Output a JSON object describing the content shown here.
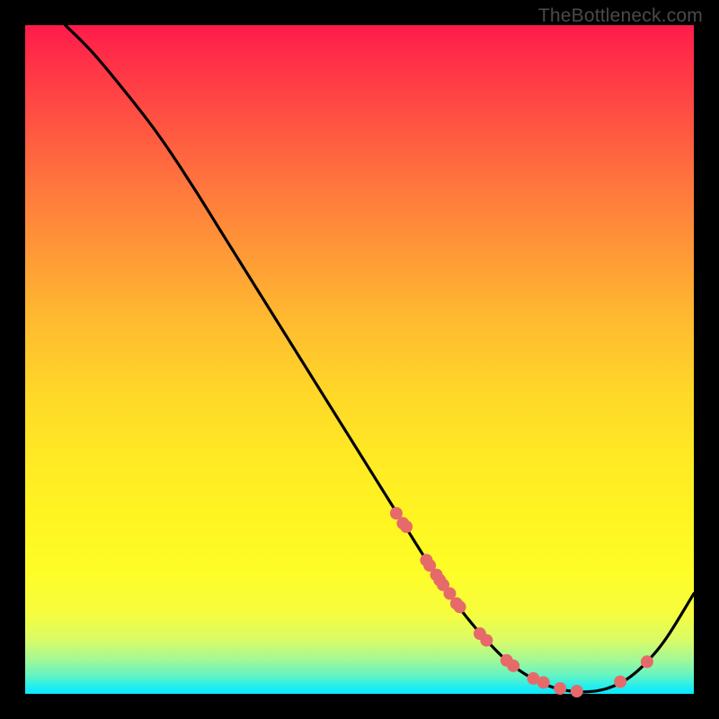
{
  "watermark": "TheBottleneck.com",
  "chart_data": {
    "type": "line",
    "title": "",
    "xlabel": "",
    "ylabel": "",
    "xlim": [
      0,
      100
    ],
    "ylim": [
      0,
      100
    ],
    "curve": {
      "x": [
        6,
        10,
        15,
        20,
        25,
        30,
        35,
        40,
        45,
        50,
        55,
        60,
        63,
        66,
        69,
        72,
        75,
        78,
        81,
        84,
        87,
        90,
        93,
        96,
        100
      ],
      "y": [
        100,
        96,
        90,
        83.5,
        76,
        68,
        60,
        52,
        44,
        36,
        28,
        20,
        15.5,
        11.5,
        8,
        5,
        2.8,
        1.3,
        0.5,
        0.3,
        0.8,
        2.2,
        4.8,
        8.5,
        15
      ]
    },
    "dots": {
      "x": [
        55.5,
        56.5,
        57,
        60,
        60.5,
        61.5,
        62,
        62.5,
        63.5,
        64.5,
        65,
        68,
        69,
        72,
        73,
        76,
        77.5,
        80,
        82.5,
        89,
        93
      ],
      "y": [
        27,
        25.5,
        25,
        20,
        19.2,
        17.8,
        17,
        16.3,
        15,
        13.5,
        13,
        9,
        8,
        5,
        4.2,
        2.3,
        1.7,
        0.8,
        0.4,
        1.8,
        4.8
      ]
    },
    "dot_color": "#e76a6a",
    "dot_radius": 7
  }
}
